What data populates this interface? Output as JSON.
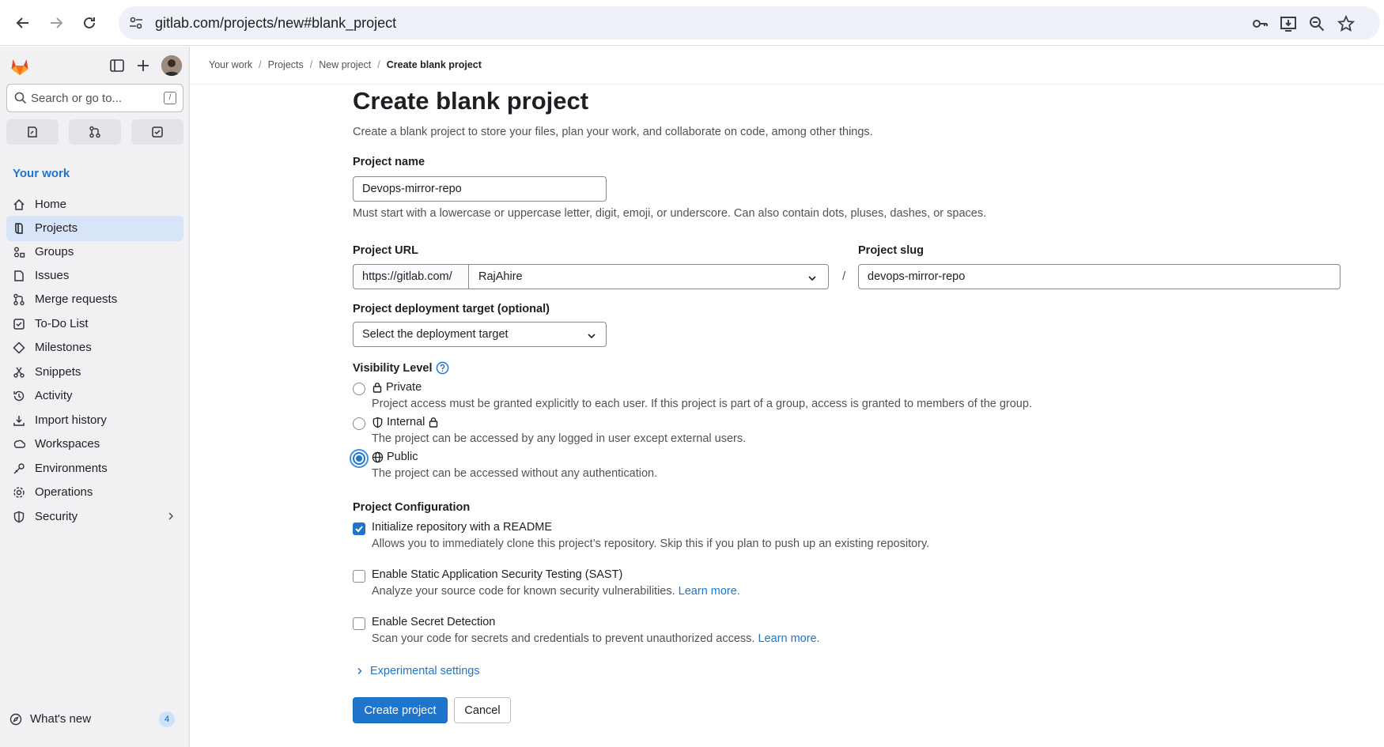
{
  "browser": {
    "url": "gitlab.com/projects/new#blank_project"
  },
  "sidebar": {
    "search_placeholder": "Search or go to...",
    "search_shortcut": "/",
    "section_title": "Your work",
    "items": [
      {
        "label": "Home",
        "icon": "home-icon"
      },
      {
        "label": "Projects",
        "icon": "project-icon",
        "active": true
      },
      {
        "label": "Groups",
        "icon": "group-icon"
      },
      {
        "label": "Issues",
        "icon": "issues-icon"
      },
      {
        "label": "Merge requests",
        "icon": "merge-request-icon"
      },
      {
        "label": "To-Do List",
        "icon": "todo-icon"
      },
      {
        "label": "Milestones",
        "icon": "milestone-icon"
      },
      {
        "label": "Snippets",
        "icon": "snippet-icon"
      },
      {
        "label": "Activity",
        "icon": "history-icon"
      },
      {
        "label": "Import history",
        "icon": "import-icon"
      },
      {
        "label": "Workspaces",
        "icon": "workspace-icon"
      },
      {
        "label": "Environments",
        "icon": "environment-icon"
      },
      {
        "label": "Operations",
        "icon": "cloud-gear-icon"
      },
      {
        "label": "Security",
        "icon": "shield-icon"
      }
    ],
    "whats_new": {
      "label": "What's new",
      "count": "4"
    }
  },
  "breadcrumb": [
    "Your work",
    "Projects",
    "New project",
    "Create blank project"
  ],
  "page": {
    "title": "Create blank project",
    "description": "Create a blank project to store your files, plan your work, and collaborate on code, among other things."
  },
  "form": {
    "project_name": {
      "label": "Project name",
      "value": "Devops-mirror-repo",
      "help": "Must start with a lowercase or uppercase letter, digit, emoji, or underscore. Can also contain dots, pluses, dashes, or spaces."
    },
    "project_url": {
      "label": "Project URL",
      "prefix": "https://gitlab.com/",
      "namespace": "RajAhire",
      "separator": "/"
    },
    "project_slug": {
      "label": "Project slug",
      "value": "devops-mirror-repo"
    },
    "deployment": {
      "label": "Project deployment target (optional)",
      "value": "Select the deployment target"
    },
    "visibility": {
      "label": "Visibility Level",
      "options": [
        {
          "label": "Private",
          "desc": "Project access must be granted explicitly to each user. If this project is part of a group, access is granted to members of the group.",
          "checked": false
        },
        {
          "label": "Internal",
          "desc": "The project can be accessed by any logged in user except external users.",
          "checked": false
        },
        {
          "label": "Public",
          "desc": "The project can be accessed without any authentication.",
          "checked": true
        }
      ]
    },
    "configuration": {
      "label": "Project Configuration",
      "options": [
        {
          "label": "Initialize repository with a README",
          "desc": "Allows you to immediately clone this project’s repository. Skip this if you plan to push up an existing repository.",
          "checked": true,
          "link": ""
        },
        {
          "label": "Enable Static Application Security Testing (SAST)",
          "desc": "Analyze your source code for known security vulnerabilities.",
          "checked": false,
          "link": "Learn more."
        },
        {
          "label": "Enable Secret Detection",
          "desc": "Scan your code for secrets and credentials to prevent unauthorized access.",
          "checked": false,
          "link": "Learn more."
        }
      ]
    },
    "experimental": "Experimental settings",
    "submit": "Create project",
    "cancel": "Cancel"
  },
  "colors": {
    "accent": "#1f75cb",
    "sidebar_bg": "#f1f1f3",
    "active_item": "#d8e4f8"
  }
}
